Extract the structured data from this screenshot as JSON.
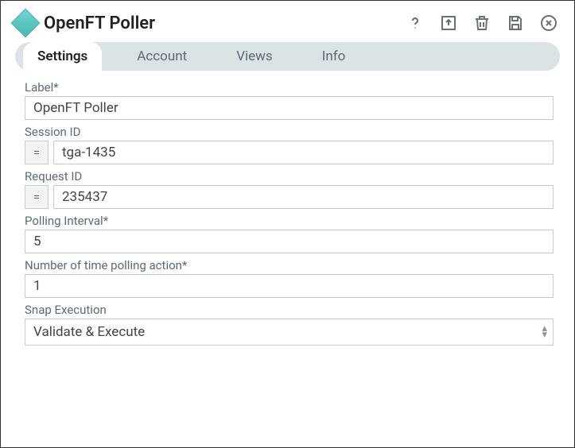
{
  "header": {
    "title": "OpenFT Poller"
  },
  "tabs": {
    "settings": "Settings",
    "account": "Account",
    "views": "Views",
    "info": "Info"
  },
  "fields": {
    "label": {
      "label": "Label*",
      "value": "OpenFT Poller"
    },
    "session_id": {
      "label": "Session ID",
      "value": "tga-1435",
      "eq": "="
    },
    "request_id": {
      "label": "Request ID",
      "value": "235437",
      "eq": "="
    },
    "polling_interval": {
      "label": "Polling Interval*",
      "value": "5"
    },
    "poll_count": {
      "label": "Number of time polling action*",
      "value": "1"
    },
    "snap_exec": {
      "label": "Snap Execution",
      "value": "Validate & Execute"
    }
  }
}
